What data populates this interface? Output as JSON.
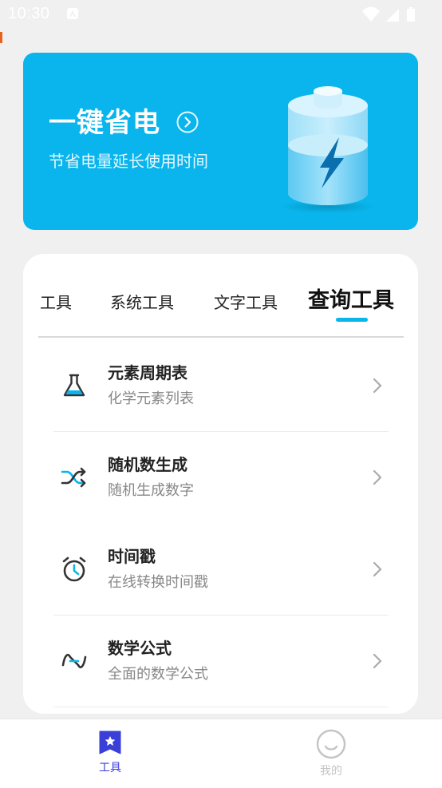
{
  "status_bar": {
    "time": "10:30"
  },
  "banner": {
    "title": "一键省电",
    "subtitle": "节省电量延长使用时间",
    "background": "#09b5ec"
  },
  "tabs": [
    {
      "label": "工具",
      "active": false
    },
    {
      "label": "系统工具",
      "active": false
    },
    {
      "label": "文字工具",
      "active": false
    },
    {
      "label": "查询工具",
      "active": true
    }
  ],
  "list": [
    {
      "title": "元素周期表",
      "subtitle": "化学元素列表",
      "icon": "flask-icon"
    },
    {
      "title": "随机数生成",
      "subtitle": "随机生成数字",
      "icon": "shuffle-icon"
    },
    {
      "title": "时间戳",
      "subtitle": "在线转换时间戳",
      "icon": "alarm-clock-icon"
    },
    {
      "title": "数学公式",
      "subtitle": "全面的数学公式",
      "icon": "sine-wave-icon"
    }
  ],
  "bottom_nav": [
    {
      "label": "工具",
      "icon": "bookmark-star-icon",
      "active": true
    },
    {
      "label": "我的",
      "icon": "smiley-icon",
      "active": false
    }
  ],
  "colors": {
    "accent": "#09b5ec",
    "nav_active": "#3a3fd8",
    "nav_inactive": "#c4c4c4"
  }
}
